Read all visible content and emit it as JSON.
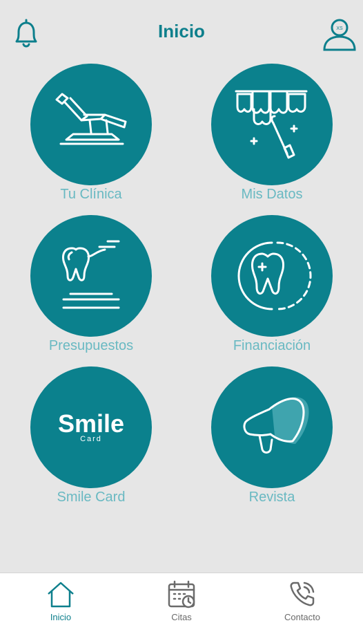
{
  "header": {
    "title": "Inicio",
    "left_icon": "bell-icon",
    "right_icon": "user-profile-icon",
    "profile_initials": "XS"
  },
  "tiles": [
    {
      "label": "Tu Clínica",
      "icon": "dental-chair-icon"
    },
    {
      "label": "Mis Datos",
      "icon": "teeth-tool-icon"
    },
    {
      "label": "Presupuestos",
      "icon": "tooth-document-icon"
    },
    {
      "label": "Financiación",
      "icon": "tooth-cycle-icon"
    },
    {
      "label": "Smile Card",
      "icon": "smile-card-logo",
      "logo_word": "Smile",
      "logo_sub": "Card"
    },
    {
      "label": "Revista",
      "icon": "megaphone-icon"
    }
  ],
  "bottom_nav": [
    {
      "label": "Inicio",
      "icon": "home-icon",
      "active": true
    },
    {
      "label": "Citas",
      "icon": "calendar-clock-icon",
      "active": false
    },
    {
      "label": "Contacto",
      "icon": "phone-icon",
      "active": false
    }
  ],
  "colors": {
    "accent": "#0b818d",
    "label": "#69b9c2",
    "background": "#e6e6e6",
    "nav_bg": "#ffffff"
  }
}
